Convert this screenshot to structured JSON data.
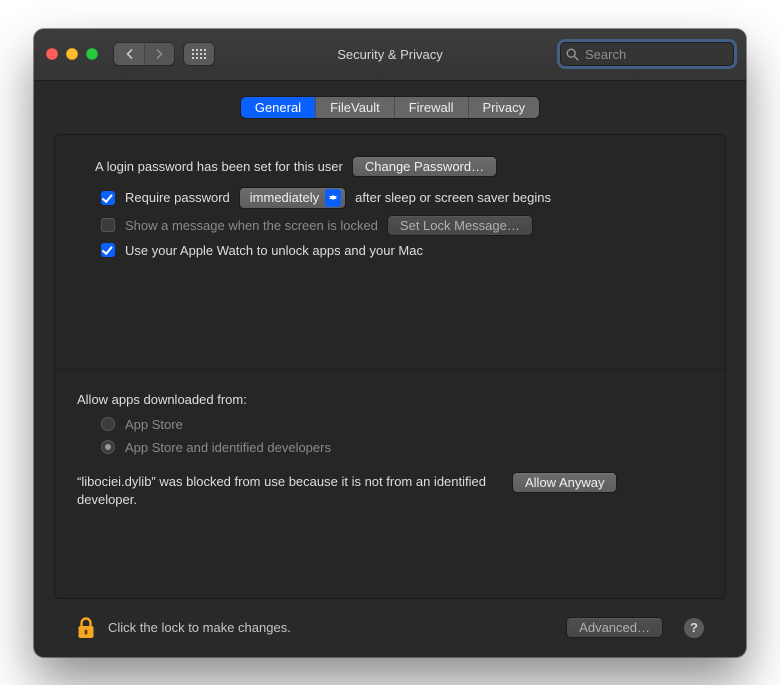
{
  "window": {
    "title": "Security & Privacy"
  },
  "search": {
    "placeholder": "Search"
  },
  "tabs": {
    "items": [
      "General",
      "FileVault",
      "Firewall",
      "Privacy"
    ],
    "active_index": 0
  },
  "general": {
    "login_text": "A login password has been set for this user",
    "change_password_btn": "Change Password…",
    "require_pw_label_pre": "Require password",
    "require_pw_delay": "immediately",
    "require_pw_label_post": "after sleep or screen saver begins",
    "require_pw_checked": true,
    "show_message_label": "Show a message when the screen is locked",
    "show_message_checked": false,
    "set_lock_message_btn": "Set Lock Message…",
    "apple_watch_label": "Use your Apple Watch to unlock apps and your Mac",
    "apple_watch_checked": true,
    "allow_apps_header": "Allow apps downloaded from:",
    "allow_apps_options": [
      "App Store",
      "App Store and identified developers"
    ],
    "allow_apps_selected_index": 1,
    "blocked_message": "“libociei.dylib” was blocked from use because it is not from an identified developer.",
    "allow_anyway_btn": "Allow Anyway"
  },
  "footer": {
    "lock_text": "Click the lock to make changes.",
    "advanced_btn": "Advanced…"
  }
}
